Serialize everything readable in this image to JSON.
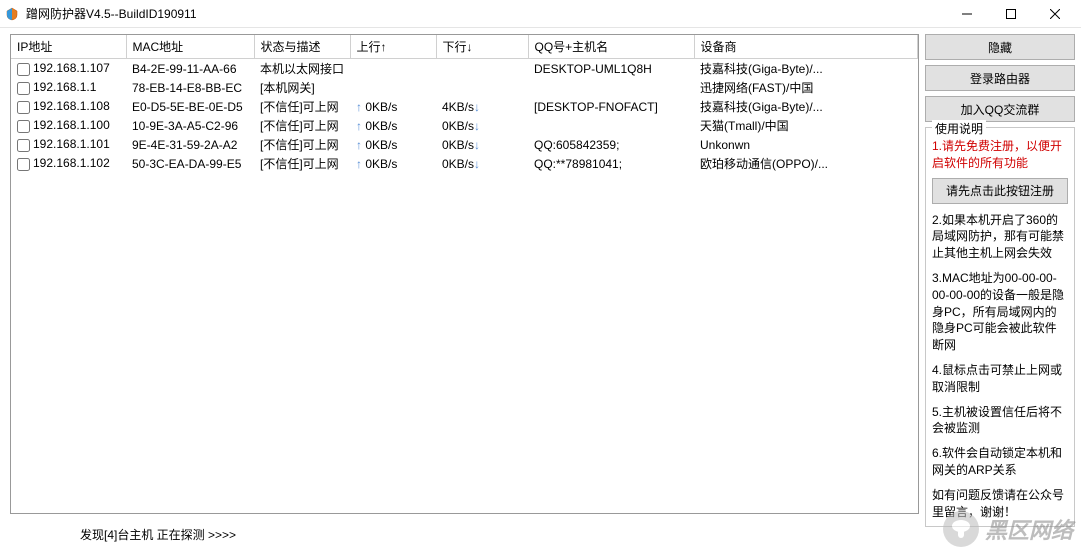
{
  "title": "蹭网防护器V4.5--BuildID190911",
  "columns": {
    "ip": "IP地址",
    "mac": "MAC地址",
    "state": "状态与描述",
    "up": "上行↑",
    "down": "下行↓",
    "qq": "QQ号+主机名",
    "vendor": "设备商"
  },
  "rows": [
    {
      "ip": "192.168.1.107",
      "mac": "B4-2E-99-11-AA-66",
      "state": "本机以太网接口",
      "up": "",
      "down": "",
      "qq": "DESKTOP-UML1Q8H",
      "vendor": "技嘉科技(Giga-Byte)/..."
    },
    {
      "ip": "192.168.1.1",
      "mac": "78-EB-14-E8-BB-EC",
      "state": "[本机网关]",
      "up": "",
      "down": "",
      "qq": "",
      "vendor": "迅捷网络(FAST)/中国"
    },
    {
      "ip": "192.168.1.108",
      "mac": "E0-D5-5E-BE-0E-D5",
      "state": "[不信任]可上网",
      "up": "0KB/s",
      "down": "4KB/s",
      "qq": "[DESKTOP-FNOFACT]",
      "vendor": "技嘉科技(Giga-Byte)/..."
    },
    {
      "ip": "192.168.1.100",
      "mac": "10-9E-3A-A5-C2-96",
      "state": "[不信任]可上网",
      "up": "0KB/s",
      "down": "0KB/s",
      "qq": "",
      "vendor": "天猫(Tmall)/中国"
    },
    {
      "ip": "192.168.1.101",
      "mac": "9E-4E-31-59-2A-A2",
      "state": "[不信任]可上网",
      "up": "0KB/s",
      "down": "0KB/s",
      "qq": "QQ:605842359;",
      "vendor": "Unkonwn"
    },
    {
      "ip": "192.168.1.102",
      "mac": "50-3C-EA-DA-99-E5",
      "state": "[不信任]可上网",
      "up": "0KB/s",
      "down": "0KB/s",
      "qq": "QQ:**78981041;",
      "vendor": "欧珀移动通信(OPPO)/..."
    }
  ],
  "buttons": {
    "hide": "隐藏",
    "router": "登录路由器",
    "qqgroup": "加入QQ交流群",
    "register": "请先点击此按钮注册"
  },
  "instructions": {
    "heading": "使用说明",
    "red": "1.请先免费注册，以便开启软件的所有功能",
    "i2": "2.如果本机开启了360的局域网防护，那有可能禁止其他主机上网会失效",
    "i3": "3.MAC地址为00-00-00-00-00-00的设备一般是隐身PC，所有局域网内的隐身PC可能会被此软件断网",
    "i4": "4.鼠标点击可禁止上网或取消限制",
    "i5": "5.主机被设置信任后将不会被监测",
    "i6": "6.软件会自动锁定本机和网关的ARP关系",
    "i7": "如有问题反馈请在公众号里留言，谢谢！"
  },
  "status": "发现[4]台主机  正在探测 >>>>",
  "watermark": "黑区网络"
}
